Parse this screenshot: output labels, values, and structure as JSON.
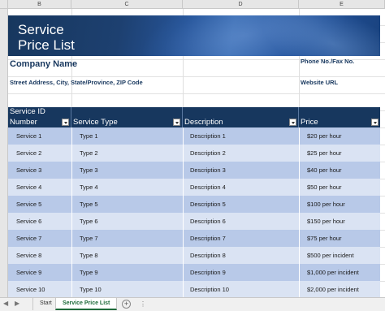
{
  "columns": [
    "B",
    "C",
    "D",
    "E"
  ],
  "banner": {
    "title_line1": "Service",
    "title_line2": "Price List"
  },
  "company": {
    "name": "Company Name",
    "phone_fax": "Phone No./Fax No.",
    "address": "Street Address, City, State/Province, ZIP Code",
    "website": "Website URL"
  },
  "table": {
    "headers": {
      "service_id_line1": "Service ID",
      "service_id_line2": "Number",
      "service_type": "Service Type",
      "description": "Description",
      "price": "Price"
    },
    "rows": [
      {
        "id": "Service 1",
        "type": "Type 1",
        "desc": "Description 1",
        "price": "$20 per hour"
      },
      {
        "id": "Service 2",
        "type": "Type 2",
        "desc": "Description 2",
        "price": "$25 per hour"
      },
      {
        "id": "Service 3",
        "type": "Type 3",
        "desc": "Description 3",
        "price": "$40 per hour"
      },
      {
        "id": "Service 4",
        "type": "Type 4",
        "desc": "Description 4",
        "price": "$50 per hour"
      },
      {
        "id": "Service 5",
        "type": "Type 5",
        "desc": "Description 5",
        "price": "$100 per hour"
      },
      {
        "id": "Service 6",
        "type": "Type 6",
        "desc": "Description 6",
        "price": "$150 per hour"
      },
      {
        "id": "Service 7",
        "type": "Type 7",
        "desc": "Description 7",
        "price": "$75 per hour"
      },
      {
        "id": "Service 8",
        "type": "Type 8",
        "desc": "Description 8",
        "price": "$500 per incident"
      },
      {
        "id": "Service 9",
        "type": "Type 9",
        "desc": "Description 9",
        "price": "$1,000 per incident"
      },
      {
        "id": "Service 10",
        "type": "Type 10",
        "desc": "Description 10",
        "price": "$2,000 per incident"
      }
    ]
  },
  "sheet_tabs": {
    "nav_prev": "◀",
    "nav_next": "▶",
    "tabs": [
      "Start",
      "Service Price List"
    ],
    "active": "Service Price List",
    "add": "+",
    "more": "⋮"
  },
  "colors": {
    "header_bg": "#17375e",
    "row_odd": "#b8c9e8",
    "row_even": "#dae3f3",
    "active_tab": "#1e6b3a"
  }
}
